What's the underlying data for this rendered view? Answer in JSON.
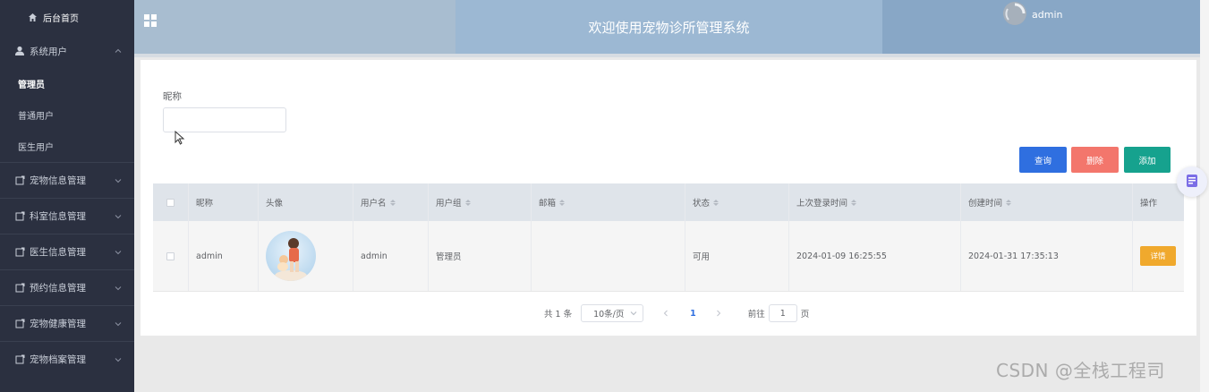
{
  "sidebar": {
    "home": "后台首页",
    "group": {
      "label": "系统用户",
      "items": [
        "管理员",
        "普通用户",
        "医生用户"
      ]
    },
    "menus": [
      "宠物信息管理",
      "科室信息管理",
      "医生信息管理",
      "预约信息管理",
      "宠物健康管理",
      "宠物档案管理"
    ]
  },
  "header": {
    "title": "欢迎使用宠物诊所管理系统",
    "username": "admin"
  },
  "search": {
    "label": "昵称",
    "value": "",
    "placeholder": ""
  },
  "actions": {
    "query": "查询",
    "delete": "删除",
    "add": "添加"
  },
  "table": {
    "columns": [
      "昵称",
      "头像",
      "用户名",
      "用户组",
      "邮箱",
      "状态",
      "上次登录时间",
      "创建时间",
      "操作"
    ],
    "rows": [
      {
        "nickname": "admin",
        "username": "admin",
        "group": "管理员",
        "email": "",
        "status": "可用",
        "last_login": "2024-01-09 16:25:55",
        "created": "2024-01-31 17:35:13",
        "detail": "详情"
      }
    ]
  },
  "pagination": {
    "total": "共 1 条",
    "page_size": "10条/页",
    "current": "1",
    "goto": "前往",
    "goto_value": "1",
    "unit": "页"
  },
  "watermark": "CSDN @全栈工程司",
  "colors": {
    "sidebar": "#2b3040",
    "header": "#a8bdd0",
    "primary": "#2f6fe0",
    "danger": "#f3766c",
    "success": "#16a28e",
    "warning": "#f0a92d"
  }
}
